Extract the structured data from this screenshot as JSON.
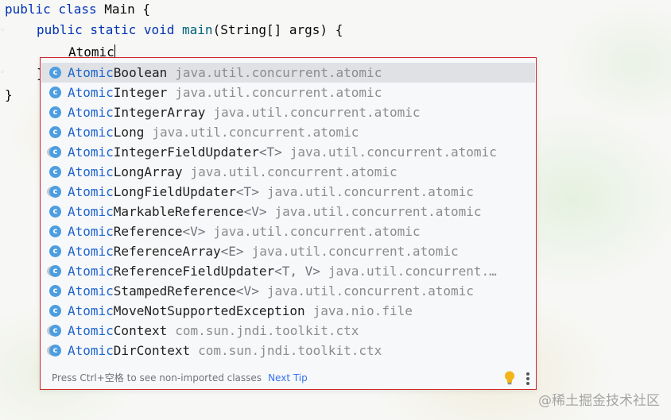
{
  "editor": {
    "lines": [
      {
        "kw": "public class ",
        "rest": "Main {"
      },
      {
        "kw": "public static void ",
        "fn": "main",
        "rest": "(String[] args) {"
      },
      {
        "rest": "Atomic"
      },
      {
        "rest": "}"
      },
      {
        "rest": "}"
      }
    ]
  },
  "completion": {
    "items": [
      {
        "match": "Atomic",
        "rest": "Boolean",
        "generic": "",
        "package": "java.util.concurrent.atomic",
        "abstract": false,
        "selected": true
      },
      {
        "match": "Atomic",
        "rest": "Integer",
        "generic": "",
        "package": "java.util.concurrent.atomic",
        "abstract": false,
        "selected": false
      },
      {
        "match": "Atomic",
        "rest": "IntegerArray",
        "generic": "",
        "package": "java.util.concurrent.atomic",
        "abstract": false,
        "selected": false
      },
      {
        "match": "Atomic",
        "rest": "Long",
        "generic": "",
        "package": "java.util.concurrent.atomic",
        "abstract": false,
        "selected": false
      },
      {
        "match": "Atomic",
        "rest": "IntegerFieldUpdater",
        "generic": "<T>",
        "package": "java.util.concurrent.atomic",
        "abstract": true,
        "selected": false
      },
      {
        "match": "Atomic",
        "rest": "LongArray",
        "generic": "",
        "package": "java.util.concurrent.atomic",
        "abstract": false,
        "selected": false
      },
      {
        "match": "Atomic",
        "rest": "LongFieldUpdater",
        "generic": "<T>",
        "package": "java.util.concurrent.atomic",
        "abstract": true,
        "selected": false
      },
      {
        "match": "Atomic",
        "rest": "MarkableReference",
        "generic": "<V>",
        "package": "java.util.concurrent.atomic",
        "abstract": false,
        "selected": false
      },
      {
        "match": "Atomic",
        "rest": "Reference",
        "generic": "<V>",
        "package": "java.util.concurrent.atomic",
        "abstract": false,
        "selected": false
      },
      {
        "match": "Atomic",
        "rest": "ReferenceArray",
        "generic": "<E>",
        "package": "java.util.concurrent.atomic",
        "abstract": false,
        "selected": false
      },
      {
        "match": "Atomic",
        "rest": "ReferenceFieldUpdater",
        "generic": "<T, V>",
        "package": "java.util.concurrent.…",
        "abstract": true,
        "selected": false
      },
      {
        "match": "Atomic",
        "rest": "StampedReference",
        "generic": "<V>",
        "package": "java.util.concurrent.atomic",
        "abstract": false,
        "selected": false
      },
      {
        "match": "Atomic",
        "rest": "MoveNotSupportedException",
        "generic": "",
        "package": "java.nio.file",
        "abstract": false,
        "selected": false
      },
      {
        "match": "Atomic",
        "rest": "Context",
        "generic": "",
        "package": "com.sun.jndi.toolkit.ctx",
        "abstract": true,
        "selected": false
      },
      {
        "match": "Atomic",
        "rest": "DirContext",
        "generic": "",
        "package": "com.sun.jndi.toolkit.ctx",
        "abstract": true,
        "selected": false
      }
    ],
    "icon_letter": "c",
    "footer_text": "Press Ctrl+空格 to see non-imported classes",
    "next_tip_label": "Next Tip",
    "bulb_icon": "lightbulb-icon",
    "more_icon": "more-vertical-icon"
  },
  "watermark": "@稀土掘金技术社区",
  "colors": {
    "match": "#1e64cc",
    "keyword": "#0033b3",
    "class_icon": "#4d9ee0",
    "popup_border": "#d0252b",
    "selection": "#dfe1e5",
    "link": "#3574f0"
  }
}
